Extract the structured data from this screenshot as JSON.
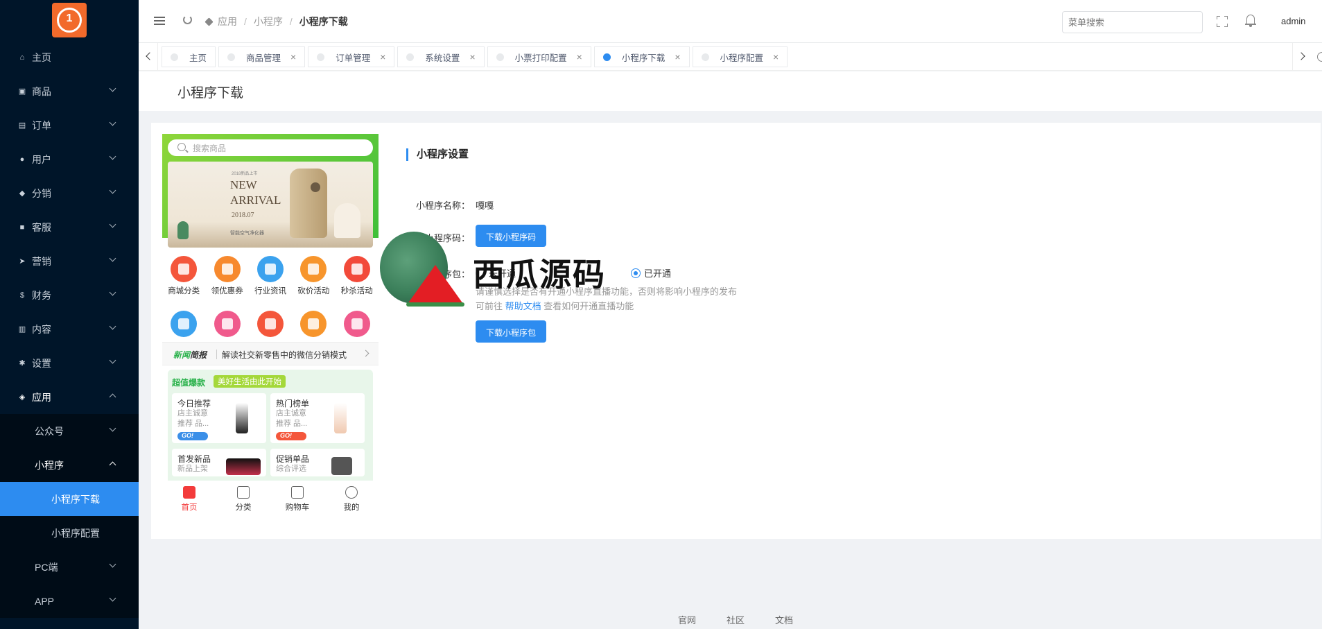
{
  "sidebar": {
    "items": [
      {
        "label": "主页"
      },
      {
        "label": "商品"
      },
      {
        "label": "订单"
      },
      {
        "label": "用户"
      },
      {
        "label": "分销"
      },
      {
        "label": "客服"
      },
      {
        "label": "营销"
      },
      {
        "label": "财务"
      },
      {
        "label": "内容"
      },
      {
        "label": "设置"
      },
      {
        "label": "应用"
      }
    ],
    "sub_items": [
      {
        "label": "公众号"
      },
      {
        "label": "小程序"
      }
    ],
    "subsub_items": [
      {
        "label": "小程序下载"
      },
      {
        "label": "小程序配置"
      }
    ],
    "more_items": [
      {
        "label": "PC端"
      },
      {
        "label": "APP"
      }
    ]
  },
  "header": {
    "breadcrumb": [
      "应用",
      "小程序",
      "小程序下载"
    ],
    "search_placeholder": "菜单搜索",
    "user": "admin"
  },
  "tabs": [
    {
      "label": "主页",
      "closable": false
    },
    {
      "label": "商品管理"
    },
    {
      "label": "订单管理"
    },
    {
      "label": "系统设置"
    },
    {
      "label": "小票打印配置"
    },
    {
      "label": "小程序下载",
      "active": true
    },
    {
      "label": "小程序配置"
    }
  ],
  "page": {
    "title": "小程序下载"
  },
  "phone": {
    "search_placeholder": "搜索商品",
    "banner": {
      "small": "2018新品上市",
      "line1": "NEW",
      "line2": "ARRIVAL",
      "year": "2018.07",
      "sub": "智能空气净化器"
    },
    "icons": [
      "商城分类",
      "领优惠券",
      "行业资讯",
      "砍价活动",
      "秒杀活动"
    ],
    "news": {
      "label_a": "新闻",
      "label_b": "简报",
      "text": "解读社交新零售中的微信分销模式"
    },
    "deals": {
      "title": "超值爆款",
      "tag": "美好生活由此开始",
      "cards": [
        {
          "title": "今日推荐",
          "sub": "店主诚意推荐 品...",
          "go": "GO!"
        },
        {
          "title": "热门榜单",
          "sub": "店主诚意推荐 品...",
          "go": "GO!"
        },
        {
          "title": "首发新品",
          "sub": "新品上架"
        },
        {
          "title": "促销单品",
          "sub": "综合评选"
        }
      ]
    },
    "footer": [
      "首页",
      "分类",
      "购物车",
      "我的"
    ]
  },
  "settings": {
    "section_title": "小程序设置",
    "name_label": "小程序名称：",
    "name_value": "嘎嘎",
    "code_label": "小程序码：",
    "code_button": "下载小程序码",
    "package_label": "小程序包：",
    "radio_off": "未开通",
    "radio_on": "已开通",
    "hint_pre": "请谨慎选择是否有开通小程序直播功能，否则将影响小程序的发布 可前往",
    "hint_link": "帮助文档",
    "hint_post": "查看如何开通直播功能",
    "package_button": "下载小程序包"
  },
  "watermark": {
    "text": "西瓜源码"
  },
  "footer": {
    "links": [
      "官网",
      "社区",
      "文档"
    ]
  },
  "colors": {
    "primary": "#2d8cf0",
    "sidebar_bg": "#001529",
    "logo": "#f26a2b"
  }
}
